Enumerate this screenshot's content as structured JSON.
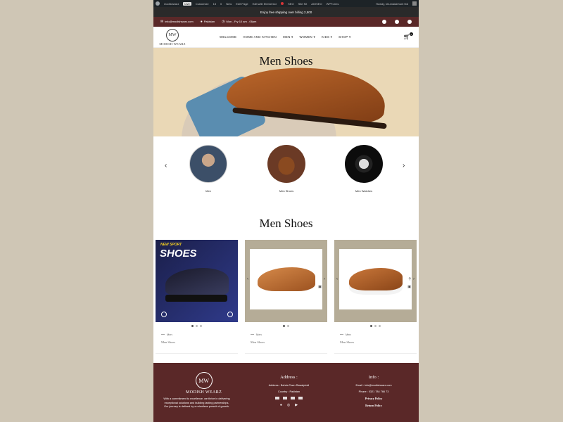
{
  "adminbar": {
    "site": "modishwarz",
    "live": "Live",
    "customize": "Customize",
    "updates": "15",
    "comments": "0",
    "new": "New",
    "edit": "Edit Page",
    "elementor": "Edit with Elementor",
    "seo": "SEO",
    "site_kit": "Site Kit",
    "aioseo": "AIOSEO",
    "wp_forms": "WPForms",
    "howdy": "Howdy, khumaiabhunt tbd"
  },
  "promo": {
    "text": "Enjoy free shipping over billing 2,500"
  },
  "infobar": {
    "email": "info@modishwarz.com",
    "country": "Pakistan",
    "hours": "Mon - Fry 10 am - 06pm"
  },
  "nav": {
    "logo_mono": "MW",
    "logo_text": "MODISH WEARZ",
    "items": [
      "WELCOME",
      "HOME AND KITCHEN",
      "MEN",
      "WOMEN",
      "KIDS",
      "SHOP"
    ],
    "cart_count": "0"
  },
  "hero": {
    "title": "Men Shoes"
  },
  "categories": [
    {
      "label": "Men"
    },
    {
      "label": "Men Shoes"
    },
    {
      "label": "Men Watches"
    }
  ],
  "section": {
    "title": "Men Shoes"
  },
  "products": [
    {
      "badge": "NEW SPORT",
      "headline": "SHOES",
      "category": "Men",
      "name": "Men Shoes"
    },
    {
      "category": "Men",
      "name": "Men Shoes"
    },
    {
      "category": "Men",
      "name": "Men Shoes"
    }
  ],
  "footer": {
    "logo_mono": "MW",
    "logo_text": "MODISH WEARZ",
    "about": "With a commitment to excellence, we thrive in delivering exceptional solutions and building lasting partnerships. Our journey is defined by a relentless pursuit of growth.",
    "address_heading": "Address :",
    "address": "Address : Bahria Town Rawalpindi",
    "country": "Country : Pakistan",
    "info_heading": "Info :",
    "email": "Email : info@modishwarz.com",
    "phone": "Phone : 0321 784 766 73",
    "privacy": "Privacy Policy",
    "returns": "Return Policy"
  }
}
